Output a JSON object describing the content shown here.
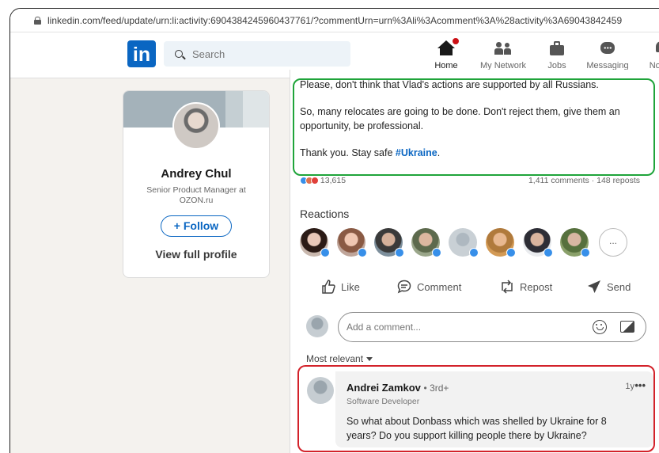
{
  "browser": {
    "url": "linkedin.com/feed/update/urn:li:activity:6904384245960437761/?commentUrn=urn%3Ali%3Acomment%3A%28activity%3A69043842459"
  },
  "nav": {
    "logo": "in",
    "search_placeholder": "Search",
    "items": [
      {
        "label": "Home",
        "icon": "home-icon"
      },
      {
        "label": "My Network",
        "icon": "network-icon"
      },
      {
        "label": "Jobs",
        "icon": "jobs-icon"
      },
      {
        "label": "Messaging",
        "icon": "messaging-icon"
      },
      {
        "label": "Notific",
        "icon": "bell-icon"
      }
    ]
  },
  "profile": {
    "name": "Andrey Chul",
    "headline": "Senior Product Manager at OZON.ru",
    "follow_label": "+ Follow",
    "view_profile": "View full profile"
  },
  "post": {
    "paragraphs": [
      "Please, don't think that Vlad's actions are supported by all Russians.",
      "So, many relocates are going to be done. Don't reject them, give them an opportunity, be professional."
    ],
    "closing": "Thank you. Stay safe ",
    "hashtag": "#Ukraine",
    "closing_end": ".",
    "reaction_count": "13,615",
    "comments_reposts": "1,411 comments · 148 reposts",
    "reactions_title": "Reactions",
    "more_reactors": "...",
    "actions": {
      "like": "Like",
      "comment": "Comment",
      "repost": "Repost",
      "send": "Send"
    },
    "comment_placeholder": "Add a comment...",
    "sort_label": "Most relevant"
  },
  "comment": {
    "author": "Andrei Zamkov",
    "degree": "• 3rd+",
    "author_title": "Software Developer",
    "time": "1y",
    "more": "•••",
    "text": "So what about Donbass which was shelled by Ukraine for 8 years? Do you support killing people there by Ukraine?"
  },
  "colors": {
    "brand": "#0a66c2",
    "highlight_green": "#1fa43a",
    "highlight_red": "#d3222a"
  }
}
